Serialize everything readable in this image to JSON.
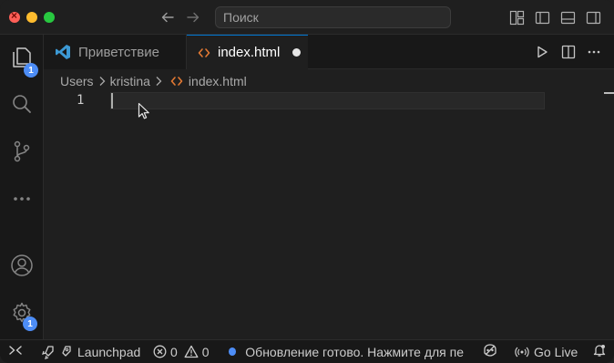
{
  "titlebar": {
    "search_placeholder": "Поиск"
  },
  "activity_bar": {
    "explorer_badge": "1",
    "manage_badge": "1"
  },
  "tabs": [
    {
      "label": "Приветствие",
      "active": false
    },
    {
      "label": "index.html",
      "active": true,
      "dirty": true
    }
  ],
  "breadcrumb": {
    "segments": [
      "Users",
      "kristina",
      "index.html"
    ]
  },
  "editor": {
    "line_numbers": [
      "1"
    ]
  },
  "status_bar": {
    "launchpad": "Launchpad",
    "errors": "0",
    "warnings": "0",
    "update_message": "Обновление готово. Нажмите для пе",
    "go_live": "Go Live"
  },
  "colors": {
    "accent": "#0078d4",
    "badge": "#4d8df6",
    "html_icon": "#e37933",
    "vscode_logo": "#3c99d4"
  }
}
